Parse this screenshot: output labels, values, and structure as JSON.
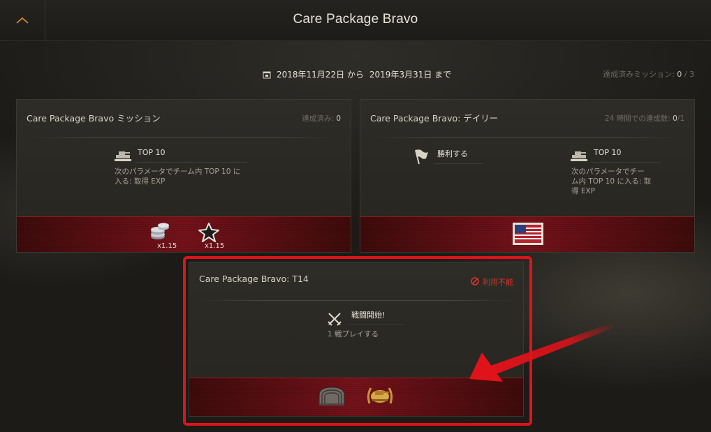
{
  "header": {
    "title": "Care Package Bravo"
  },
  "period": {
    "from": "2018年11月22日 から",
    "to": "2019年3月31日 まで"
  },
  "total_progress": {
    "label": "達成済みミッション:",
    "done": "0",
    "total": "/ 3"
  },
  "cards": {
    "missions": {
      "title": "Care Package Bravo ミッション",
      "stat_label": "達成済み:",
      "stat_value": "0",
      "condition_title": "TOP 10",
      "condition_desc_1": "次のパラメータでチーム内 TOP 10 に",
      "condition_desc_2": "入る: 取得 EXP",
      "rewards": [
        {
          "icon": "credits-coins-icon",
          "multiplier": "x1.15"
        },
        {
          "icon": "star-exp-icon",
          "multiplier": "x1.15"
        }
      ]
    },
    "daily": {
      "title": "Care Package Bravo: デイリー",
      "stat_label": "24 時間での達成数:",
      "stat_value": "0",
      "stat_total": "/1",
      "condition_1_title": "勝利する",
      "condition_2_title": "TOP 10",
      "condition_2_desc_1": "次のパラメータでチー",
      "condition_2_desc_2": "ム内 TOP 10 に入る: 取",
      "condition_2_desc_3": "得 EXP",
      "reward_icon": "us-flag-stamp-icon"
    },
    "t14": {
      "title": "Care Package Bravo: T14",
      "status": "利用不能",
      "condition_title": "戦闘開始!",
      "condition_desc": "1 戦プレイする",
      "rewards": [
        {
          "icon": "hangar-slot-icon"
        },
        {
          "icon": "gold-tank-emblem-icon"
        }
      ]
    }
  },
  "colors": {
    "accent_orange": "#e08a2a",
    "highlight_red": "#e0121a",
    "band_red": "#75121a",
    "unavailable_red": "#d8352b"
  }
}
